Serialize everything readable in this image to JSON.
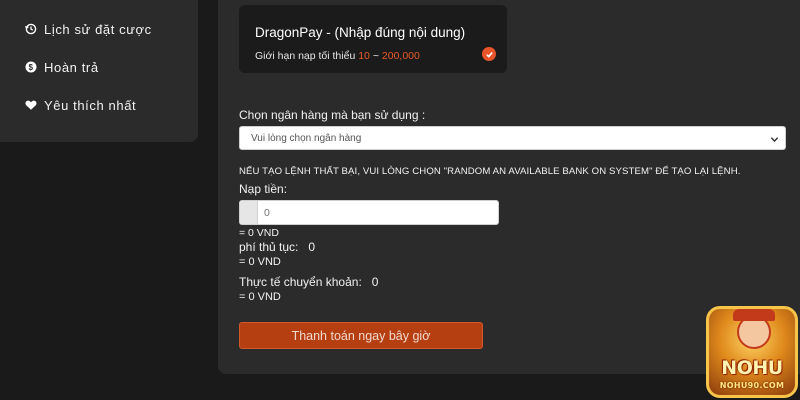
{
  "sidebar": {
    "items": [
      {
        "label": "Lịch sử đặt cược",
        "icon": "history-icon"
      },
      {
        "label": "Hoàn trả",
        "icon": "dollar-coin-icon"
      },
      {
        "label": "Yêu thích nhất",
        "icon": "heart-icon"
      }
    ]
  },
  "payment_method": {
    "title": "DragonPay - (Nhập đúng nội dung)",
    "limit_prefix": "Giới hạn nạp tối thiểu",
    "limit_min": "10",
    "limit_sep": "~",
    "limit_max": "200,000",
    "selected_icon": "check-circle-icon"
  },
  "bank": {
    "label": "Chọn ngân hàng mà bạn sử dụng :",
    "placeholder": "Vui lòng chọn ngân hàng"
  },
  "warning": "NẾU TẠO LỆNH THẤT BẠI, VUI LÒNG CHỌN \"RANDOM AN AVAILABLE BANK ON SYSTEM\" ĐỂ TẠO LẠI LỆNH.",
  "deposit": {
    "label": "Nạp tiền:",
    "placeholder": "0",
    "converted": "= 0 VND"
  },
  "fee": {
    "label": "phí thủ tục:",
    "value": "0",
    "converted": "= 0 VND"
  },
  "actual": {
    "label": "Thực tế chuyển khoản:",
    "value": "0",
    "converted": "= 0 VND"
  },
  "pay_button": "Thanh toán ngay bây giờ",
  "logo": {
    "word": "NOHU",
    "sub": "NOHU90.COM"
  },
  "colors": {
    "accent": "#e8552a",
    "button": "#b63f12",
    "panel": "#2b2b2b",
    "background": "#1a1a1a"
  }
}
